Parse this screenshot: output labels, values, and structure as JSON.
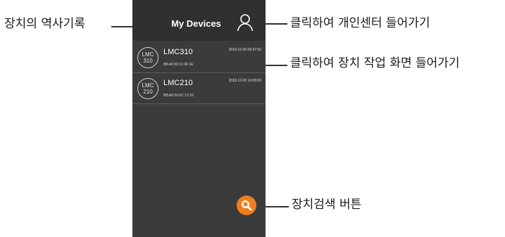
{
  "annotations": {
    "history": "장치의 역사기록",
    "personal_center": "클릭하여 개인센터 들어가기",
    "device_screen": "클릭하여 장치 작업 화면 들어가기",
    "search_button": "장치검색 버튼"
  },
  "header": {
    "title": "My Devices",
    "profile_icon": "user-icon"
  },
  "devices": [
    {
      "badge_top": "LMC",
      "badge_bottom": "310",
      "name": "LMC310",
      "timestamp": "2019-12-03 09:47:52",
      "mac": "BB:A0:50:11:0F:1E"
    },
    {
      "badge_top": "LMC",
      "badge_bottom": "210",
      "name": "LMC210",
      "timestamp": "2019-12-02 14:55:00",
      "mac": "BB:A0:50:0C:12:16"
    }
  ],
  "search": {
    "icon": "search-icon"
  },
  "colors": {
    "app_background": "#3a3b3a",
    "header_background": "#2f302f",
    "accent": "#f07d21"
  }
}
